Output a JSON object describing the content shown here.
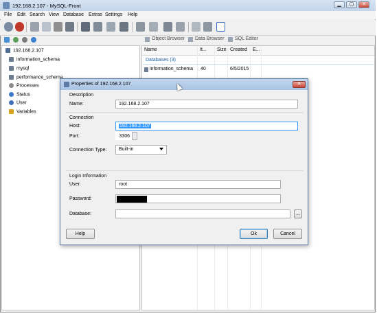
{
  "window": {
    "title": "192.168.2.107 - MySQL-Front",
    "minimize_glyph": "▁",
    "maximize_glyph": "▢",
    "close_glyph": "✕"
  },
  "menu": [
    "File",
    "Edit",
    "Search",
    "View",
    "Database",
    "Extras",
    "Settings",
    "Help"
  ],
  "view_tabs": {
    "object_browser": "Object Browser",
    "data_browser": "Data Browser",
    "sql_editor": "SQL Editor"
  },
  "tree": {
    "root": "192.168.2.107",
    "items": [
      "information_schema",
      "mysql",
      "performance_schema",
      "Processes",
      "Status",
      "User",
      "Variables"
    ]
  },
  "grid": {
    "columns": [
      "Name",
      "It...",
      "Size",
      "Created",
      "E..."
    ],
    "group_label": "Databases (3)",
    "rows": [
      {
        "name": "information_schema",
        "items": "40",
        "size": "",
        "created": "6/5/2015"
      }
    ]
  },
  "dialog": {
    "title": "Properties of 192.168.2.107",
    "close_glyph": "✕",
    "description_section": "Description",
    "name_label": "Name:",
    "name_value": "192.168.2.107",
    "connection_section": "Connection",
    "host_label": "Host:",
    "host_value": "192.168.2.107",
    "port_label": "Port:",
    "port_value": "3306",
    "connection_type_label": "Connection Type:",
    "connection_type_value": "Built-in",
    "login_section": "Login Information",
    "user_label": "User:",
    "user_value": "root",
    "password_label": "Password:",
    "database_label": "Database:",
    "database_value": "",
    "browse_label": "...",
    "help_button": "Help",
    "ok_button": "Ok",
    "cancel_button": "Cancel"
  },
  "colors": {
    "accent": "#3399ff",
    "title_gradient_top": "#c2d6ee",
    "title_gradient_bottom": "#a9c3e3",
    "close_red": "#c9483a",
    "group_text": "#1f5fa8"
  }
}
